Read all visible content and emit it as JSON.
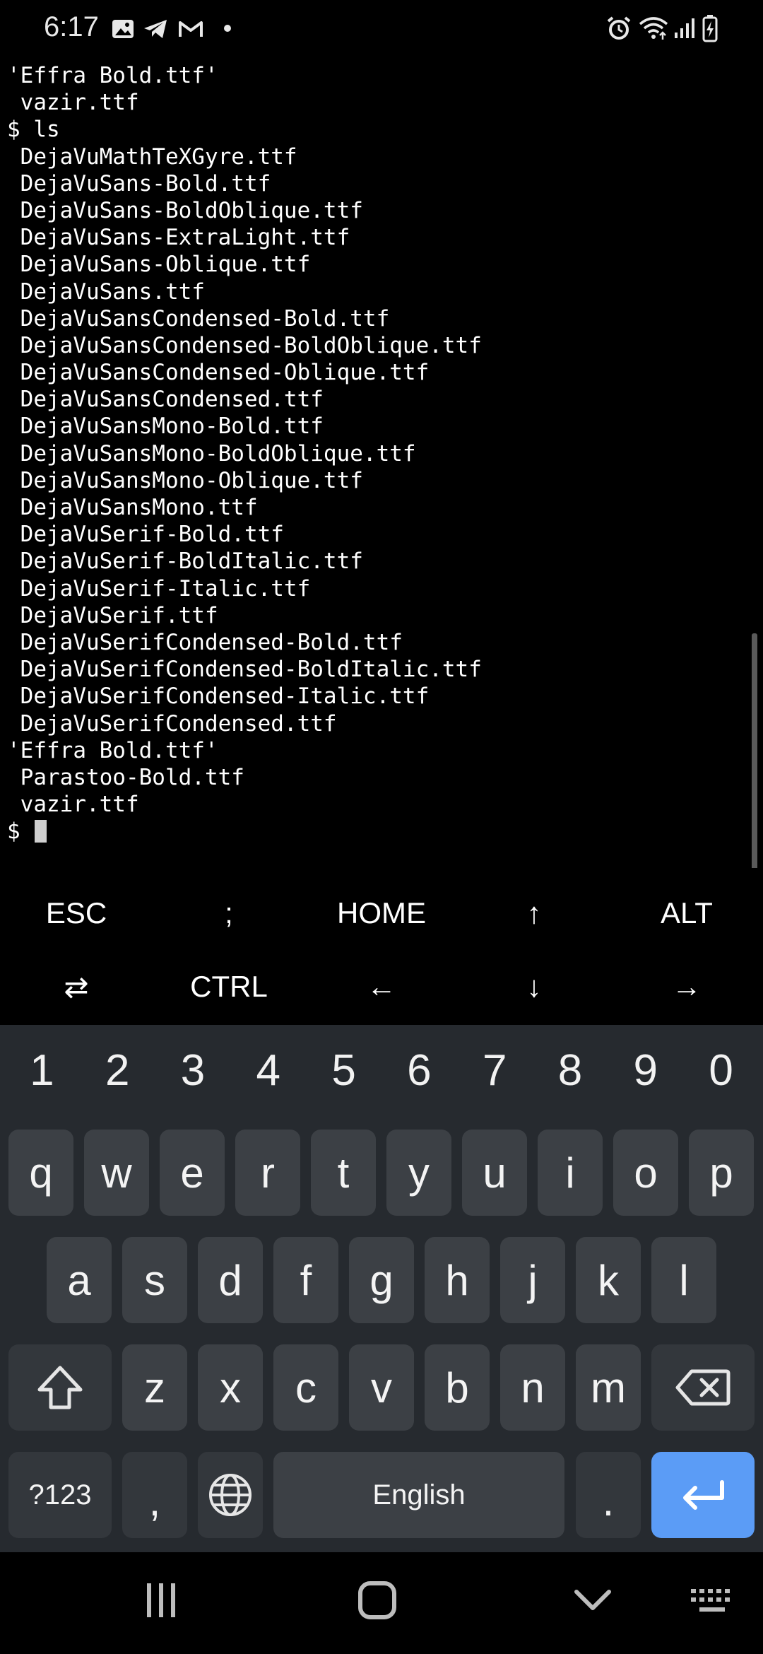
{
  "status_bar": {
    "time": "6:17",
    "left_icons": [
      "gallery-icon",
      "telegram-icon",
      "gmail-icon",
      "dot-icon"
    ],
    "right_icons": [
      "alarm-icon",
      "wifi-icon",
      "signal-icon",
      "battery-charging-icon"
    ]
  },
  "terminal": {
    "lines": [
      "'Effra Bold.ttf'",
      " vazir.ttf",
      "$ ls",
      " DejaVuMathTeXGyre.ttf",
      " DejaVuSans-Bold.ttf",
      " DejaVuSans-BoldOblique.ttf",
      " DejaVuSans-ExtraLight.ttf",
      " DejaVuSans-Oblique.ttf",
      " DejaVuSans.ttf",
      " DejaVuSansCondensed-Bold.ttf",
      " DejaVuSansCondensed-BoldOblique.ttf",
      " DejaVuSansCondensed-Oblique.ttf",
      " DejaVuSansCondensed.ttf",
      " DejaVuSansMono-Bold.ttf",
      " DejaVuSansMono-BoldOblique.ttf",
      " DejaVuSansMono-Oblique.ttf",
      " DejaVuSansMono.ttf",
      " DejaVuSerif-Bold.ttf",
      " DejaVuSerif-BoldItalic.ttf",
      " DejaVuSerif-Italic.ttf",
      " DejaVuSerif.ttf",
      " DejaVuSerifCondensed-Bold.ttf",
      " DejaVuSerifCondensed-BoldItalic.ttf",
      " DejaVuSerifCondensed-Italic.ttf",
      " DejaVuSerifCondensed.ttf",
      "'Effra Bold.ttf'",
      " Parastoo-Bold.ttf",
      " vazir.ttf"
    ],
    "prompt": "$ "
  },
  "extra_keys": {
    "row1": [
      "ESC",
      ";",
      "HOME",
      "↑",
      "ALT"
    ],
    "row2": [
      "⇄",
      "CTRL",
      "←",
      "↓",
      "→"
    ]
  },
  "keyboard": {
    "numbers": [
      "1",
      "2",
      "3",
      "4",
      "5",
      "6",
      "7",
      "8",
      "9",
      "0"
    ],
    "row1": [
      "q",
      "w",
      "e",
      "r",
      "t",
      "y",
      "u",
      "i",
      "o",
      "p"
    ],
    "row2": [
      "a",
      "s",
      "d",
      "f",
      "g",
      "h",
      "j",
      "k",
      "l"
    ],
    "row3": [
      "z",
      "x",
      "c",
      "v",
      "b",
      "n",
      "m"
    ],
    "symbols_label": "?123",
    "comma": ",",
    "space_label": "English",
    "period": ".",
    "shift_icon": "shift-icon",
    "backspace_icon": "backspace-icon",
    "globe_icon": "globe-icon",
    "enter_icon": "enter-icon",
    "enter_color": "#5b9cf6"
  },
  "nav_bar": {
    "buttons": [
      "recents-icon",
      "home-icon",
      "back-icon",
      "keyboard-switch-icon"
    ]
  }
}
